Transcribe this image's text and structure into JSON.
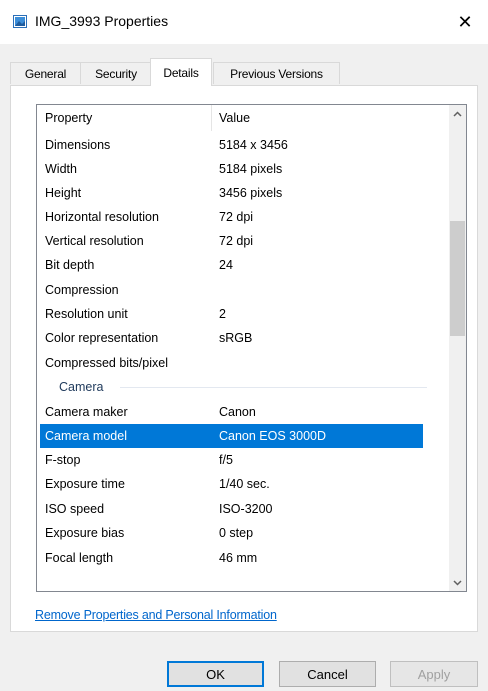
{
  "window": {
    "title": "IMG_3993 Properties",
    "close_symbol": "✕",
    "icon": "image-file-icon"
  },
  "tabs": [
    {
      "label": "General"
    },
    {
      "label": "Security"
    },
    {
      "label": "Details",
      "active": true
    },
    {
      "label": "Previous Versions"
    }
  ],
  "details": {
    "header": {
      "property": "Property",
      "value": "Value"
    },
    "image_rows": [
      {
        "name": "Dimensions",
        "value": "5184 x 3456"
      },
      {
        "name": "Width",
        "value": "5184 pixels"
      },
      {
        "name": "Height",
        "value": "3456 pixels"
      },
      {
        "name": "Horizontal resolution",
        "value": "72 dpi"
      },
      {
        "name": "Vertical resolution",
        "value": "72 dpi"
      },
      {
        "name": "Bit depth",
        "value": "24"
      },
      {
        "name": "Compression",
        "value": ""
      },
      {
        "name": "Resolution unit",
        "value": "2"
      },
      {
        "name": "Color representation",
        "value": "sRGB"
      },
      {
        "name": "Compressed bits/pixel",
        "value": ""
      }
    ],
    "camera_group": "Camera",
    "camera_rows": [
      {
        "name": "Camera maker",
        "value": "Canon"
      },
      {
        "name": "Camera model",
        "value": "Canon EOS 3000D",
        "selected": true
      },
      {
        "name": "F-stop",
        "value": "f/5"
      },
      {
        "name": "Exposure time",
        "value": "1/40 sec."
      },
      {
        "name": "ISO speed",
        "value": "ISO-3200"
      },
      {
        "name": "Exposure bias",
        "value": "0 step"
      },
      {
        "name": "Focal length",
        "value": "46 mm"
      }
    ]
  },
  "link": {
    "remove_properties": "Remove Properties and Personal Information"
  },
  "buttons": {
    "ok": "OK",
    "cancel": "Cancel",
    "apply": "Apply"
  },
  "colors": {
    "selection": "#0078d7",
    "link": "#0066cc",
    "group": "#1e395b"
  }
}
